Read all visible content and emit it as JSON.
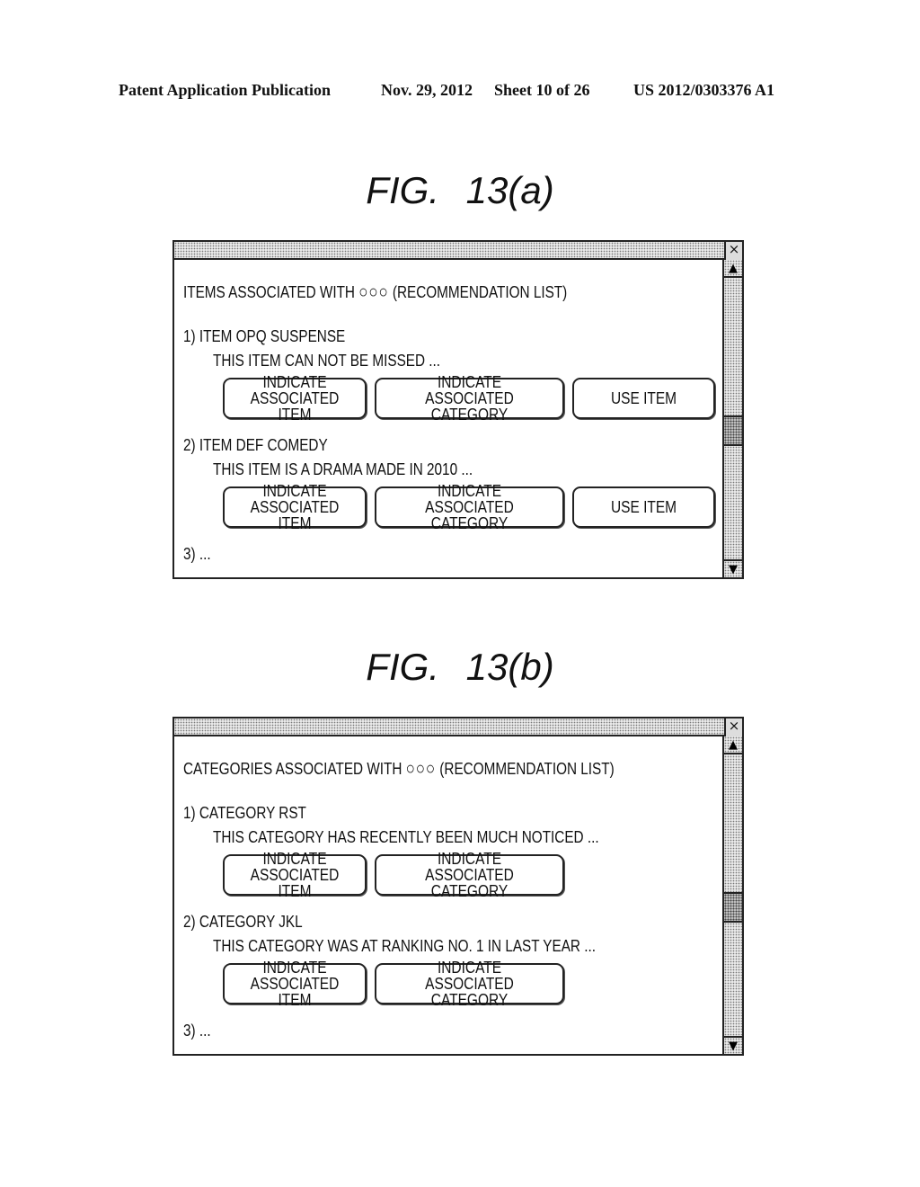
{
  "publication_header": {
    "left": "Patent Application Publication",
    "date": "Nov. 29, 2012",
    "sheet": "Sheet 10 of 26",
    "number": "US 2012/0303376 A1"
  },
  "figures": [
    {
      "label": "FIG. 13(a)",
      "window": {
        "close_icon": "×",
        "scroll_up_icon": "▲",
        "scroll_down_icon": "▼",
        "scroll_position": 0.55,
        "heading_prefix": "ITEMS ASSOCIATED WITH",
        "heading_symbol": "○○○",
        "heading_suffix": "(RECOMMENDATION LIST)",
        "entries": [
          {
            "title": "1) ITEM OPQ SUSPENSE",
            "description": "THIS ITEM CAN NOT BE MISSED ...",
            "buttons": [
              "INDICATE\nASSOCIATED ITEM",
              "INDICATE\nASSOCIATED CATEGORY",
              "USE ITEM"
            ]
          },
          {
            "title": "2) ITEM DEF COMEDY",
            "description": "THIS ITEM IS A DRAMA MADE IN 2010 ...",
            "buttons": [
              "INDICATE\nASSOCIATED ITEM",
              "INDICATE\nASSOCIATED CATEGORY",
              "USE ITEM"
            ]
          }
        ],
        "more": "3) ..."
      }
    },
    {
      "label": "FIG. 13(b)",
      "window": {
        "close_icon": "×",
        "scroll_up_icon": "▲",
        "scroll_down_icon": "▼",
        "scroll_position": 0.55,
        "heading_prefix": "CATEGORIES ASSOCIATED WITH",
        "heading_symbol": "○○○",
        "heading_suffix": "(RECOMMENDATION LIST)",
        "entries": [
          {
            "title": "1) CATEGORY RST",
            "description": "THIS CATEGORY HAS RECENTLY BEEN MUCH NOTICED ...",
            "buttons": [
              "INDICATE\nASSOCIATED ITEM",
              "INDICATE\nASSOCIATED CATEGORY"
            ]
          },
          {
            "title": "2) CATEGORY JKL",
            "description": "THIS CATEGORY WAS AT RANKING NO. 1 IN LAST YEAR ...",
            "buttons": [
              "INDICATE\nASSOCIATED ITEM",
              "INDICATE\nASSOCIATED CATEGORY"
            ]
          }
        ],
        "more": "3) ..."
      }
    }
  ]
}
